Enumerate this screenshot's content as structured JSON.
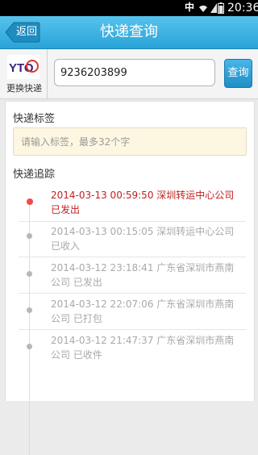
{
  "status_bar": {
    "ime": "中",
    "time": "20:36"
  },
  "header": {
    "back_label": "返回",
    "title": "快递查询"
  },
  "search": {
    "logo_text": "YTO",
    "change_courier_label": "更换快递",
    "tracking_number": "9236203899",
    "query_label": "查询"
  },
  "tag": {
    "label": "快递标签",
    "placeholder": "请输入标签，最多32个字"
  },
  "tracking": {
    "label": "快递追踪",
    "entries": [
      {
        "line1": "2014-03-13 00:59:50 深圳转运中心公司",
        "line2": "已发出",
        "active": true
      },
      {
        "line1": "2014-03-13 00:15:05 深圳转运中心公司",
        "line2": "已收入",
        "active": false
      },
      {
        "line1": "2014-03-12 23:18:41 广东省深圳市燕南",
        "line2": "公司 已发出",
        "active": false
      },
      {
        "line1": "2014-03-12 22:07:06 广东省深圳市燕南",
        "line2": "公司 已打包",
        "active": false
      },
      {
        "line1": "2014-03-12 21:47:37 广东省深圳市燕南",
        "line2": "公司 已收件",
        "active": false
      }
    ]
  },
  "colors": {
    "title_bar": "#2aa3d8",
    "active_entry": "#c21f1f",
    "inactive_entry": "#a9a9a9",
    "tag_field_bg": "#fdf7e2"
  },
  "icons": [
    "back-arrow-icon",
    "wifi-icon",
    "signal-icon",
    "battery-icon",
    "yto-logo"
  ]
}
